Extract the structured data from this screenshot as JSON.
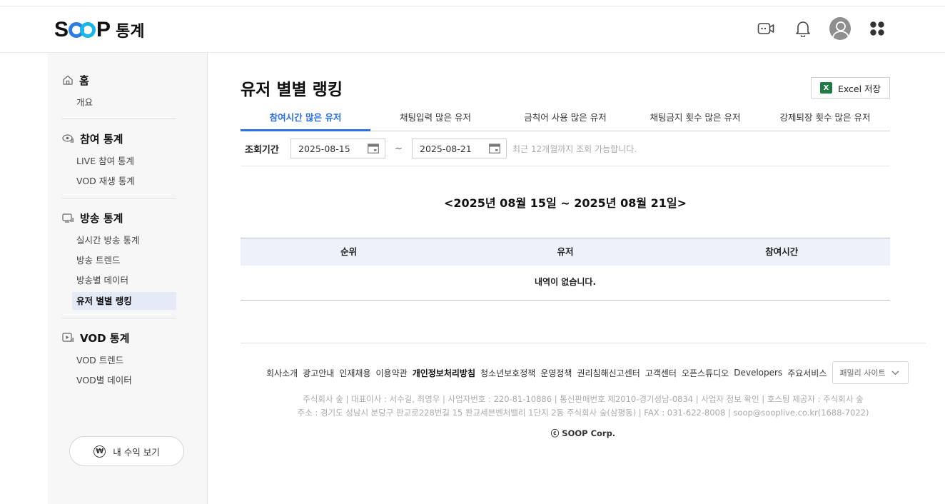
{
  "header": {
    "logo_text_s": "S",
    "logo_text_p": "P",
    "logo_sub": "통계"
  },
  "sidebar": {
    "home": {
      "title": "홈",
      "items": [
        "개요"
      ]
    },
    "participation": {
      "title": "참여 통계",
      "items": [
        "LIVE 참여 통계",
        "VOD 재생 통계"
      ]
    },
    "broadcast": {
      "title": "방송 통계",
      "items": [
        "실시간 방송 통계",
        "방송 트렌드",
        "방송별 데이터",
        "유저 별별 랭킹"
      ],
      "active_index": 3
    },
    "vod": {
      "title": "VOD 통계",
      "items": [
        "VOD 트렌드",
        "VOD별 데이터"
      ]
    },
    "earnings_button": "내 수익 보기",
    "earnings_symbol": "₩"
  },
  "main": {
    "title": "유저 별별 랭킹",
    "excel_button": "Excel 저장",
    "excel_icon_letter": "X",
    "tabs": [
      "참여시간 많은 유저",
      "채팅입력 많은 유저",
      "금칙어 사용 많은 유저",
      "채팅금지 횟수 많은 유저",
      "강제퇴장 횟수 많은 유저"
    ],
    "active_tab": 0,
    "period": {
      "label": "조회기간",
      "start": "2025-08-15",
      "separator": "~",
      "end": "2025-08-21",
      "note": "최근 12개월까지 조회 가능합니다."
    },
    "range_title": "<2025년 08월 15일 ~ 2025년 08월 21일>",
    "table": {
      "columns": [
        "순위",
        "유저",
        "참여시간"
      ],
      "empty_message": "내역이 없습니다."
    }
  },
  "footer": {
    "links": [
      "회사소개",
      "광고안내",
      "인재채용",
      "이용약관",
      "개인정보처리방침",
      "청소년보호정책",
      "운영정책",
      "권리침해신고센터",
      "고객센터",
      "오픈스튜디오",
      "Developers",
      "주요서비스"
    ],
    "bold_link_index": 4,
    "family_site": "패밀리 사이트",
    "info_line1": "주식회사 숲  |  대표이사 : 서수길, 최영우  |  사업자번호 : 220-81-10886  |  통신판매번호 제2010-경기성남-0834  |  사업자 정보 확인  |  호스팅 제공자 : 주식회사 숲",
    "info_line2": "주소 : 경기도 성남시 분당구 판교로228번길 15 판교세븐벤처밸리 1단지 2동 주식회사 숲(삼평동)  |  FAX : 031-622-8008  |  soop@sooplive.co.kr(1688-7022)",
    "copyright": "ⓒ SOOP Corp."
  },
  "colors": {
    "accent": "#2c6fe0",
    "logo_blue": "#2a7de1",
    "logo_cyan": "#19b6e8",
    "sidebar_bg": "#f7f7f7",
    "active_item_bg": "#e4eaf6",
    "table_header_bg": "#edf2fa",
    "excel_green": "#1f7a45"
  },
  "icons": {
    "header": [
      "camera-icon",
      "bell-icon",
      "user-avatar-icon",
      "apps-grid-icon"
    ],
    "sidebar": [
      "home-icon",
      "participation-icon",
      "broadcast-icon",
      "vod-icon"
    ]
  }
}
